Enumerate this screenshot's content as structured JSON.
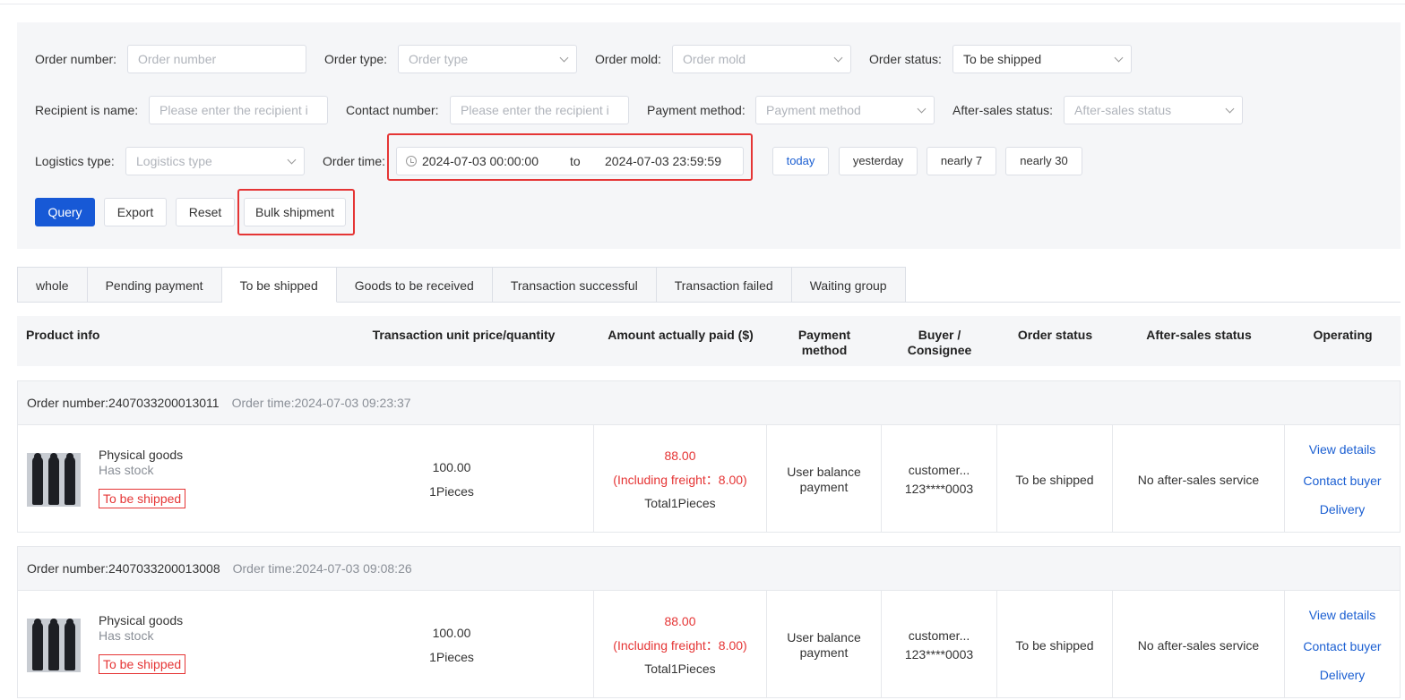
{
  "filters": {
    "order_number": {
      "label": "Order number:",
      "placeholder": "Order number"
    },
    "order_type": {
      "label": "Order type:",
      "placeholder": "Order type"
    },
    "order_mold": {
      "label": "Order mold:",
      "placeholder": "Order mold"
    },
    "order_status": {
      "label": "Order status:",
      "value": "To be shipped"
    },
    "recipient": {
      "label": "Recipient is name:",
      "placeholder": "Please enter the recipient i"
    },
    "contact": {
      "label": "Contact number:",
      "placeholder": "Please enter the recipient i"
    },
    "payment_method": {
      "label": "Payment method:",
      "placeholder": "Payment method"
    },
    "after_sales": {
      "label": "After-sales status:",
      "placeholder": "After-sales status"
    },
    "logistics": {
      "label": "Logistics type:",
      "placeholder": "Logistics type"
    },
    "order_time": {
      "label": "Order time:",
      "start": "2024-07-03 00:00:00",
      "separator": "to",
      "end": "2024-07-03 23:59:59"
    },
    "quick_ranges": [
      "today",
      "yesterday",
      "nearly 7",
      "nearly 30"
    ]
  },
  "actions": {
    "query": "Query",
    "export": "Export",
    "reset": "Reset",
    "bulk_shipment": "Bulk shipment"
  },
  "tabs": [
    "whole",
    "Pending payment",
    "To be shipped",
    "Goods to be received",
    "Transaction successful",
    "Transaction failed",
    "Waiting group"
  ],
  "columns": {
    "product_info": "Product info",
    "unit_price": "Transaction unit price/quantity",
    "amount_paid": "Amount actually paid ($)",
    "payment_method_1": "Payment",
    "payment_method_2": "method",
    "buyer_1": "Buyer /",
    "buyer_2": "Consignee",
    "order_status": "Order status",
    "after_sales_status": "After-sales status",
    "operating": "Operating"
  },
  "orders": [
    {
      "number": "Order number:2407033200013011",
      "time": "Order time:2024-07-03 09:23:37",
      "product_name": "Physical goods",
      "stock": "Has stock",
      "tag": "To be shipped",
      "unit_price": "100.00",
      "quantity": "1Pieces",
      "amount": "88.00",
      "freight": "(Including freight：8.00)",
      "total": "Total1Pieces",
      "payment_1": "User balance",
      "payment_2": "payment",
      "buyer": "customer...",
      "phone": "123****0003",
      "status": "To be shipped",
      "after_sales": "No after-sales service",
      "ops": [
        "View details",
        "Contact buyer",
        "Delivery"
      ]
    },
    {
      "number": "Order number:2407033200013008",
      "time": "Order time:2024-07-03 09:08:26",
      "product_name": "Physical goods",
      "stock": "Has stock",
      "tag": "To be shipped",
      "unit_price": "100.00",
      "quantity": "1Pieces",
      "amount": "88.00",
      "freight": "(Including freight：8.00)",
      "total": "Total1Pieces",
      "payment_1": "User balance",
      "payment_2": "payment",
      "buyer": "customer...",
      "phone": "123****0003",
      "status": "To be shipped",
      "after_sales": "No after-sales service",
      "ops": [
        "View details",
        "Contact buyer",
        "Delivery"
      ]
    }
  ],
  "colors": {
    "primary": "#1759d6",
    "link": "#1b5fd2",
    "danger": "#e53535",
    "panel_bg": "#f5f6f8"
  }
}
